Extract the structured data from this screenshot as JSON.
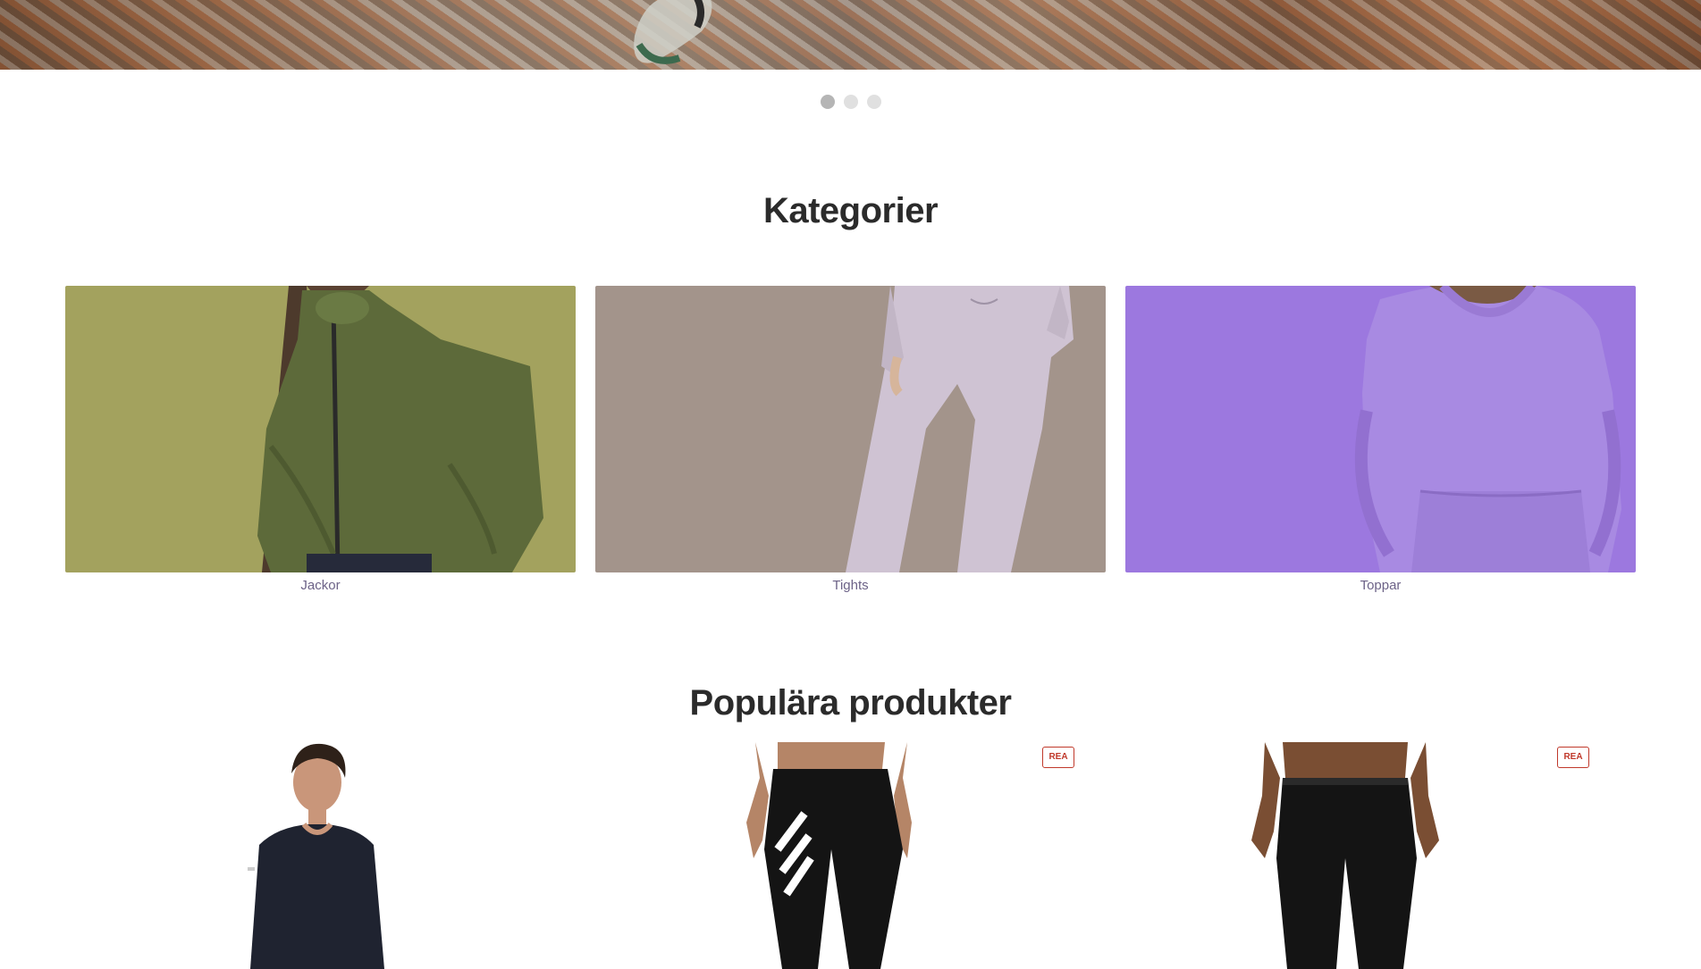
{
  "hero": {
    "slides": [
      "slide-1",
      "slide-2",
      "slide-3"
    ],
    "active_slide": 1
  },
  "categories": {
    "title": "Kategorier",
    "items": [
      {
        "label": "Jackor",
        "bg": "#a3a25e"
      },
      {
        "label": "Tights",
        "bg": "#a3948b"
      },
      {
        "label": "Toppar",
        "bg": "#9c78df"
      }
    ]
  },
  "popular": {
    "title": "Populära produkter",
    "badge_label": "REA"
  },
  "colors": {
    "text": "#2b2b2b",
    "category_label": "#6c6287",
    "sale_red": "#c0392b"
  }
}
